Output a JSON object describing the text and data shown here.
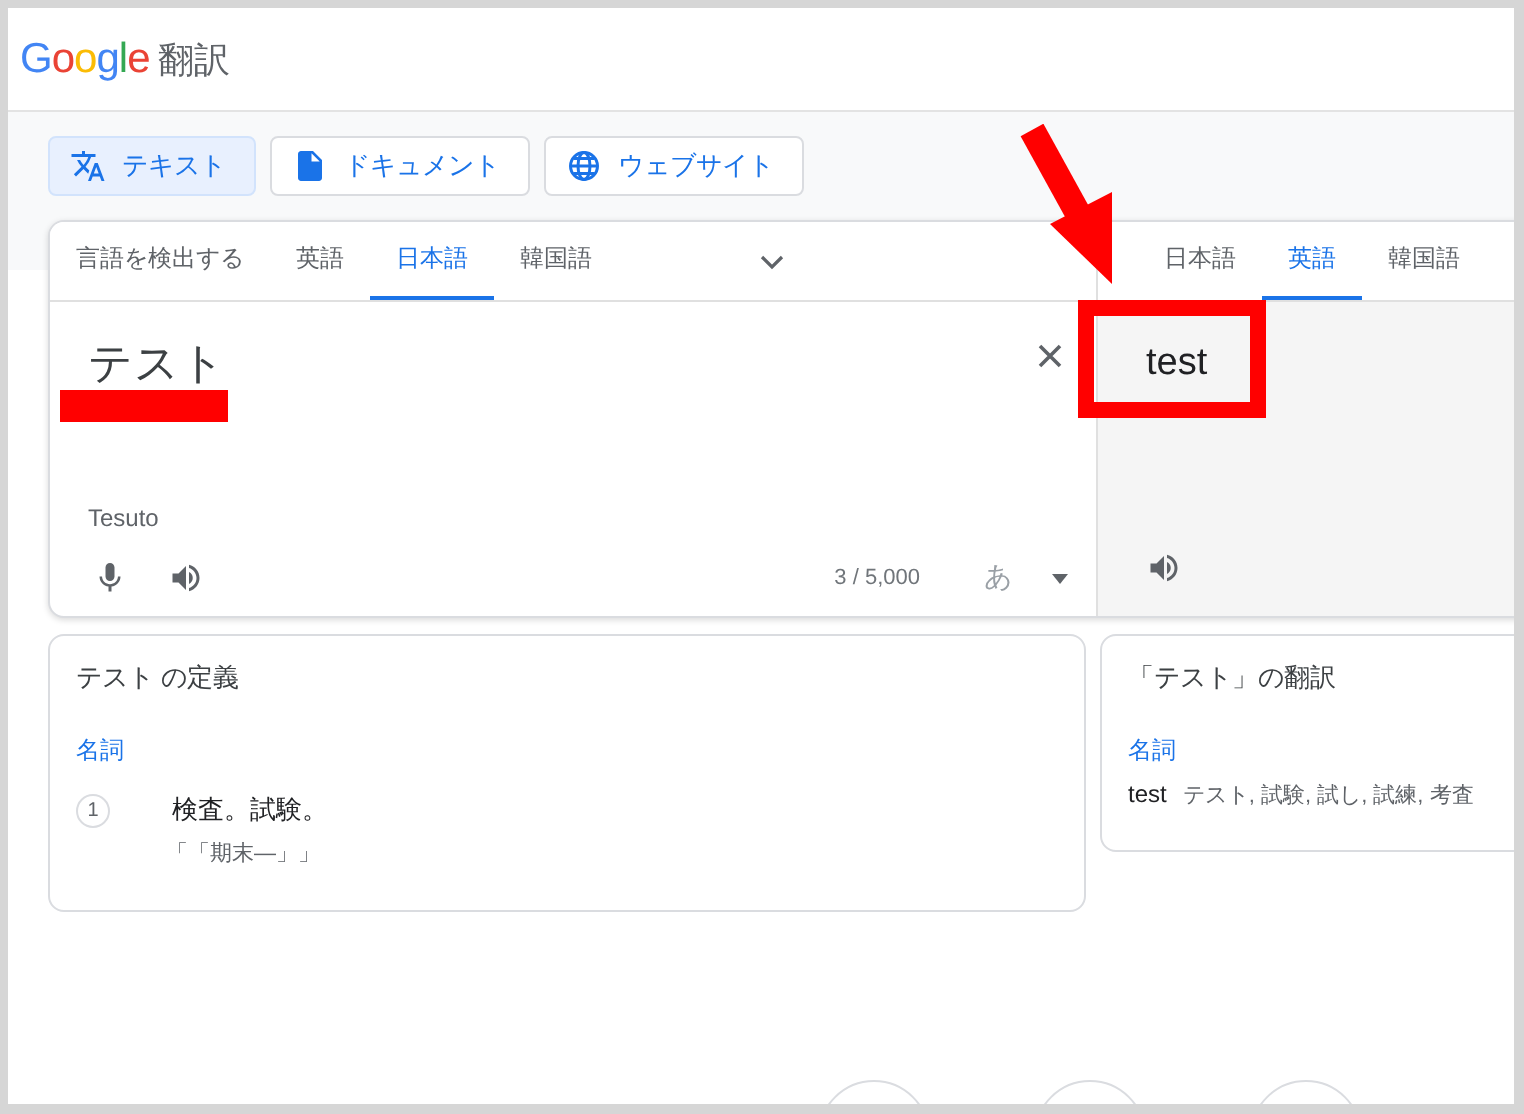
{
  "header": {
    "logo": "Google",
    "title": "翻訳"
  },
  "modes": [
    {
      "kind": "text",
      "label": "テキスト",
      "selected": true
    },
    {
      "kind": "document",
      "label": "ドキュメント",
      "selected": false
    },
    {
      "kind": "website",
      "label": "ウェブサイト",
      "selected": false
    }
  ],
  "source": {
    "tabs": [
      {
        "label": "言語を検出する",
        "selected": false
      },
      {
        "label": "英語",
        "selected": false
      },
      {
        "label": "日本語",
        "selected": true
      },
      {
        "label": "韓国語",
        "selected": false
      }
    ],
    "text": "テスト",
    "transliteration": "Tesuto",
    "char_count": "3 / 5,000",
    "input_tool": "あ"
  },
  "target": {
    "tabs": [
      {
        "label": "日本語",
        "selected": false
      },
      {
        "label": "英語",
        "selected": true
      },
      {
        "label": "韓国語",
        "selected": false
      }
    ],
    "text": "test"
  },
  "definitions": {
    "title": "テスト の定義",
    "part_of_speech": "名詞",
    "entries": [
      {
        "number": "1",
        "meaning": "検査。試験。",
        "example": "「「期末—」」"
      }
    ]
  },
  "translations": {
    "title": "「テスト」の翻訳",
    "part_of_speech": "名詞",
    "entries": [
      {
        "word": "test",
        "translations": "テスト, 試験, 試し, 試練, 考査"
      }
    ]
  }
}
